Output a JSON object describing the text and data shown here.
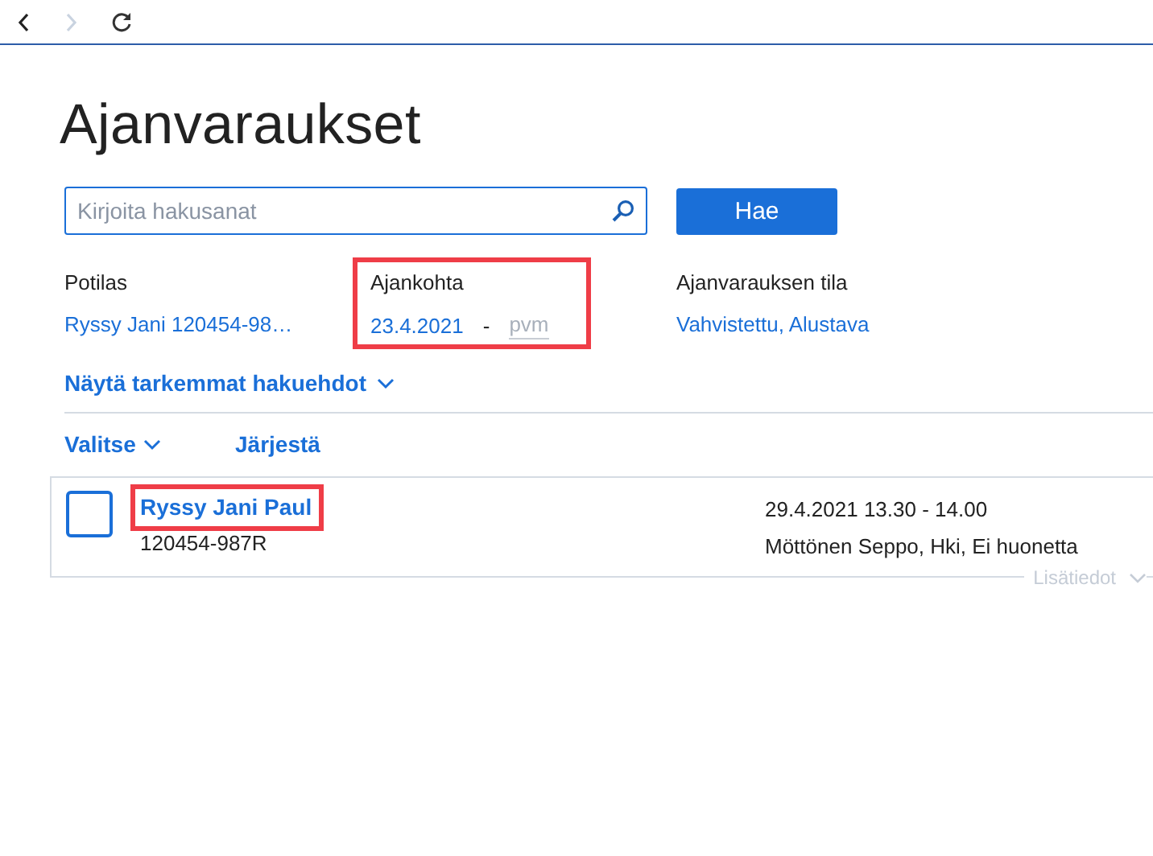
{
  "nav": {
    "back_disabled": false,
    "forward_disabled": true
  },
  "title": "Ajanvaraukset",
  "search": {
    "placeholder": "Kirjoita hakusanat",
    "button": "Hae"
  },
  "filters": [
    {
      "label": "Potilas",
      "value": "Ryssy Jani 120454-98…",
      "highlighted": false
    },
    {
      "label": "Ajankohta",
      "value": "23.4.2021",
      "separator": "-",
      "end_placeholder": "pvm",
      "highlighted": true
    },
    {
      "label": "Ajanvarauksen tila",
      "value": "Vahvistettu, Alustava",
      "highlighted": false
    }
  ],
  "more_filters": "Näytä tarkemmat hakuehdot",
  "list_actions": {
    "select": "Valitse",
    "sort": "Järjestä"
  },
  "results": [
    {
      "name": "Ryssy Jani Paul",
      "id": "120454-987R",
      "time": "29.4.2021 13.30 - 14.00",
      "details": "Möttönen Seppo, Hki, Ei huonetta",
      "more": "Lisätiedot",
      "checked": false,
      "highlighted": true
    }
  ]
}
